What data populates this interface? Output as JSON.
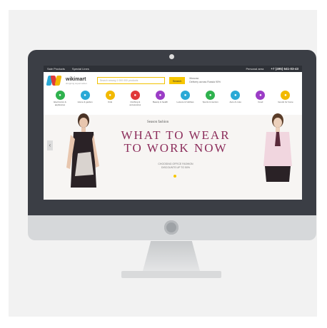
{
  "screen": {
    "topbar": {
      "link1": "Sale Products",
      "link2": "Special Lines",
      "login": "Personal area",
      "phone": "+7 (495) 641-03-43"
    },
    "header": {
      "brand": "wikimart",
      "tagline": "shopping supermarket",
      "search_placeholder": "Search among 1 000 000 products",
      "search_button": "Search",
      "delivery_line1": "Moscow",
      "delivery_line2": "Delivery across Russia 90%"
    },
    "categories": [
      {
        "label": "Electronics & appliances",
        "color": "#2fb24e"
      },
      {
        "label": "Home & garden",
        "color": "#2aa9d6"
      },
      {
        "label": "Kids",
        "color": "#f2b900"
      },
      {
        "label": "Clothing & accessories",
        "color": "#e03a3a"
      },
      {
        "label": "Beauty & health",
        "color": "#9b3cc6"
      },
      {
        "label": "Leisure & hobbies",
        "color": "#2aa9d6"
      },
      {
        "label": "Sports & tourism",
        "color": "#2fb24e"
      },
      {
        "label": "Auto & moto",
        "color": "#2aa9d6"
      },
      {
        "label": "Food",
        "color": "#9b3cc6"
      },
      {
        "label": "Goods for home",
        "color": "#f2b900"
      }
    ],
    "banner": {
      "eyebrow": "Season fashion",
      "headline_line1": "WHAT TO WEAR",
      "headline_line2": "TO WORK NOW",
      "sub_line1": "CHOOSING OFFICE FASHION",
      "sub_line2": "DISCOUNTS UP TO 50%"
    }
  },
  "colors": {
    "accent": "#f7c600",
    "headline": "#8c2d5b",
    "bezel": "#3b3e45"
  }
}
